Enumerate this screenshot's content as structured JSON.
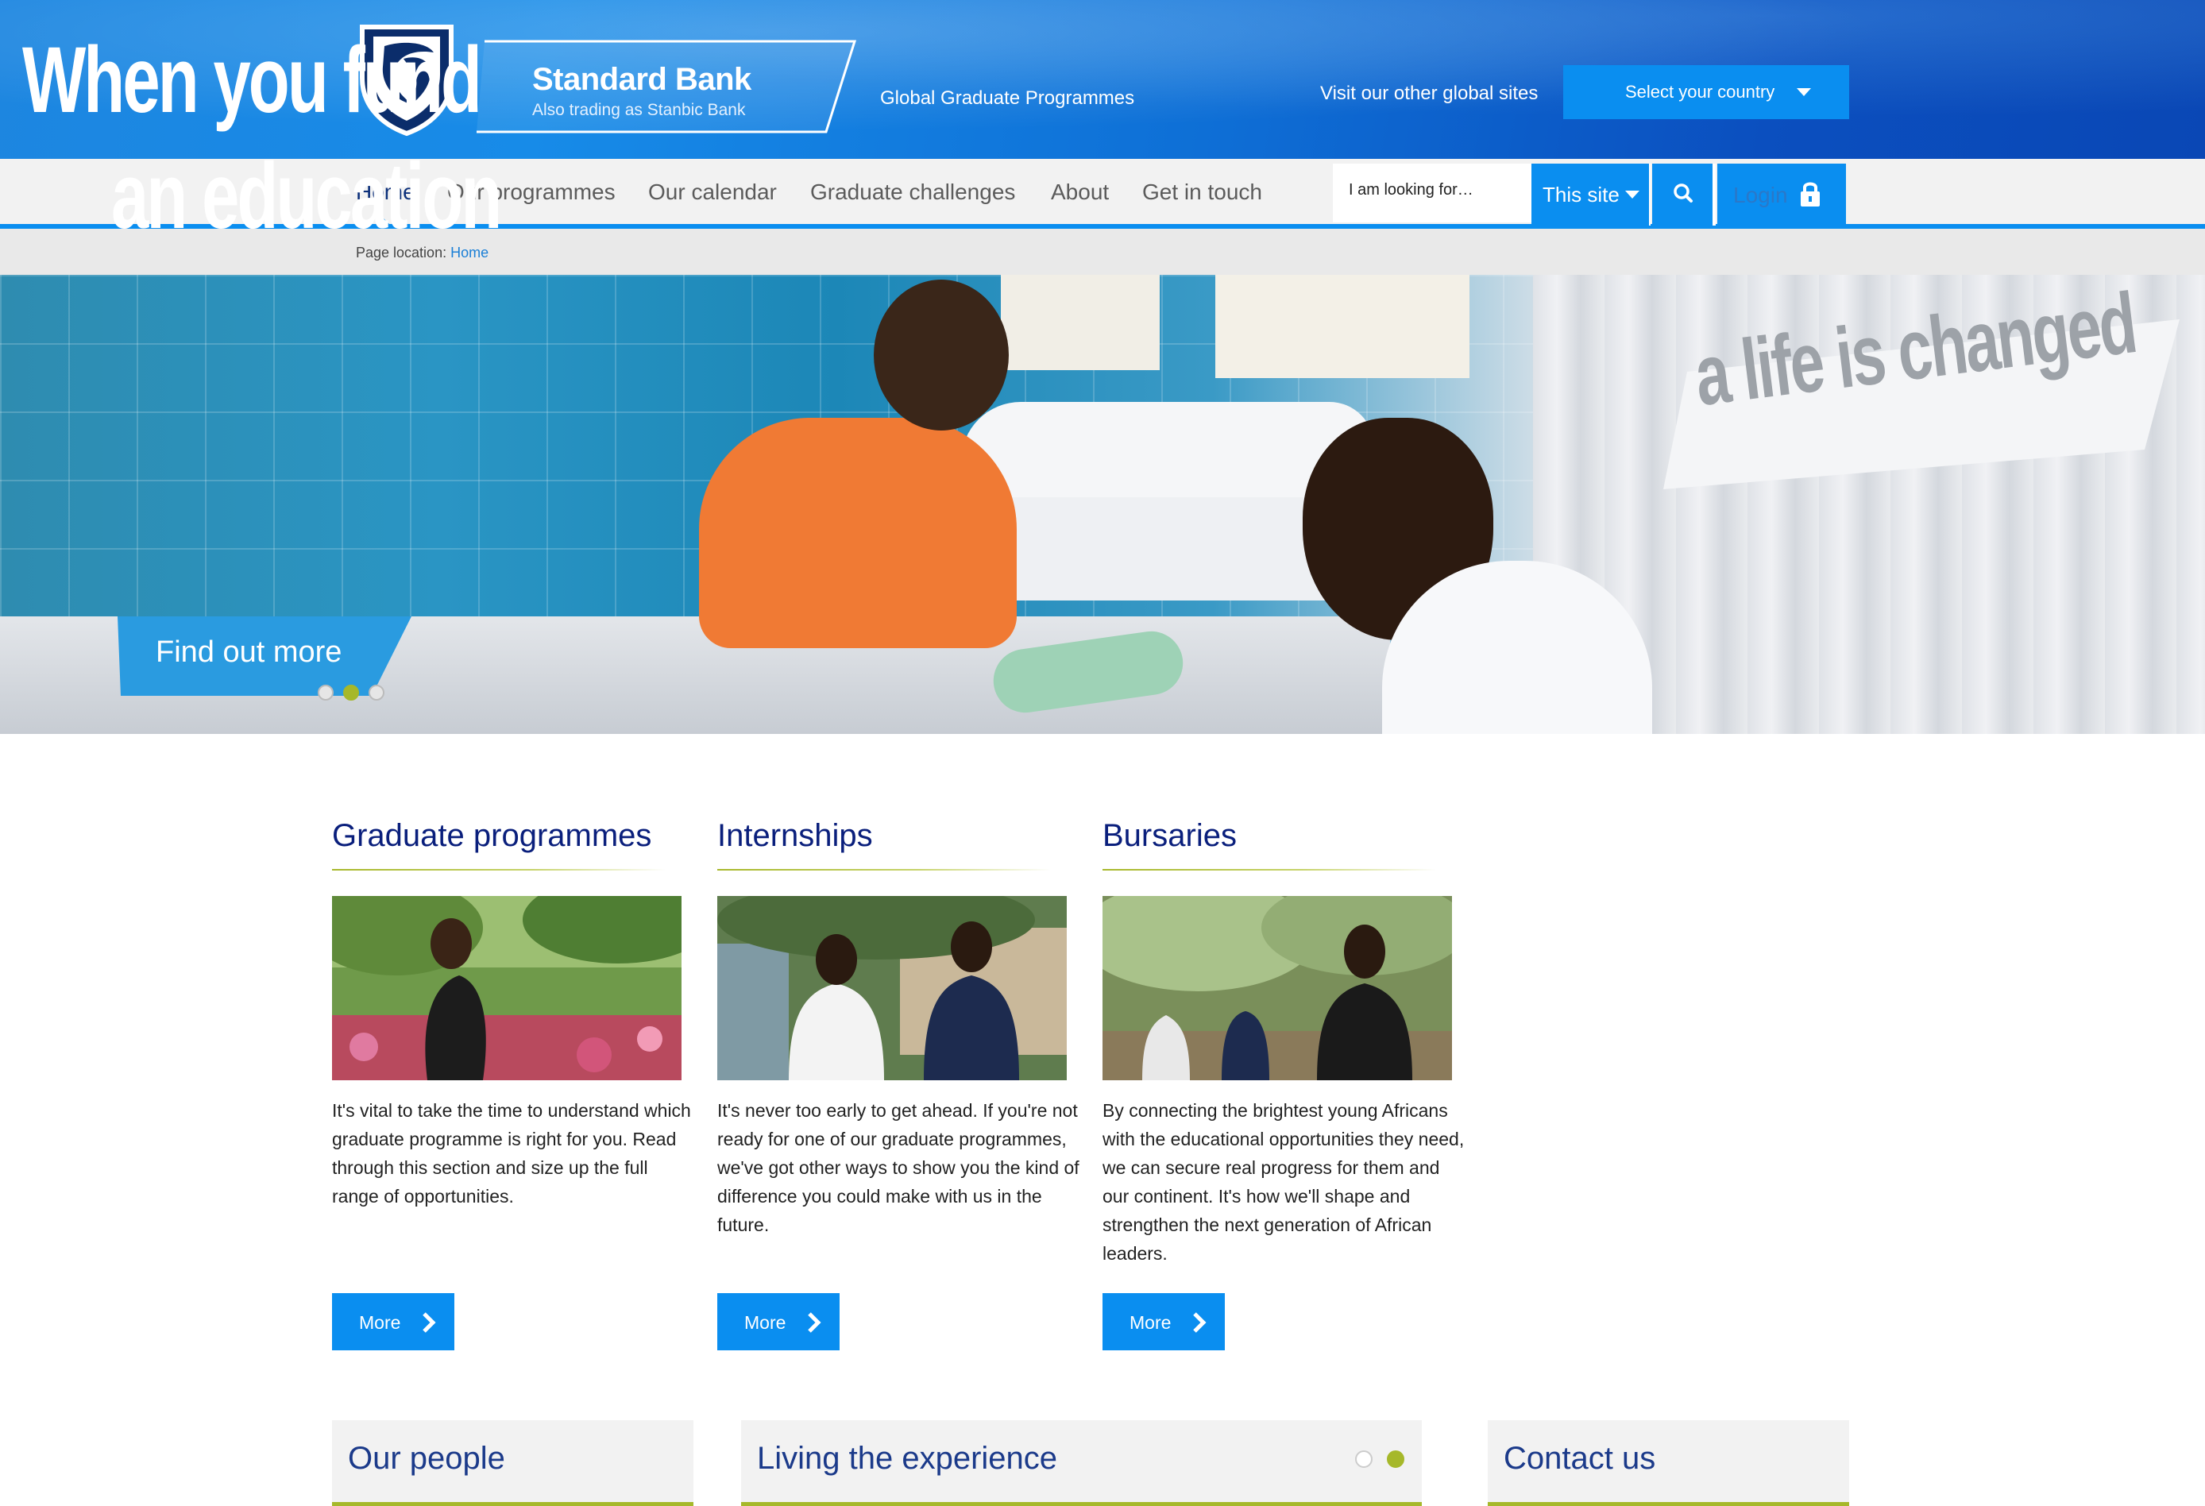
{
  "header": {
    "brand_name": "Standard Bank",
    "brand_tagline": "Also trading as Stanbic Bank",
    "site_name": "Global Graduate Programmes",
    "global_sites_label": "Visit our other global sites",
    "country_select_label": "Select your country"
  },
  "nav": {
    "items": [
      {
        "label": "Home",
        "active": true
      },
      {
        "label": "Our programmes"
      },
      {
        "label": "Our calendar"
      },
      {
        "label": "Graduate challenges"
      },
      {
        "label": "About"
      },
      {
        "label": "Get in touch"
      }
    ],
    "search_value": "I am looking for…",
    "scope_label": "This site",
    "login_label": "Login"
  },
  "breadcrumb": {
    "prefix": "Page location:",
    "current": "Home"
  },
  "hero": {
    "line1": "When you fund",
    "line2": "an education",
    "banner": "a life is changed",
    "cta": "Find out more",
    "active_slide": 2,
    "slide_count": 3
  },
  "cards": [
    {
      "title": "Graduate programmes",
      "text": "It's vital to  take the time to understand which graduate programme is right for you. Read through this section and size up the full range of opportunities.",
      "button": "More"
    },
    {
      "title": "Internships",
      "text": "It's never too early to get ahead. If you're not ready for one of our graduate programmes, we've got other ways to show you the kind of difference you could make with us in the future.",
      "button": "More"
    },
    {
      "title": "Bursaries",
      "text": "By connecting the brightest young Africans with the educational opportunities they need, we can secure real progress for them and our continent. It's how we'll shape and strengthen the next generation of African leaders.",
      "button": "More"
    }
  ],
  "panels": {
    "people": "Our people",
    "experience": "Living the experience",
    "contact": "Contact us",
    "experience_active_slide": 2
  },
  "colors": {
    "brand_blue": "#0a8ef0",
    "navy_heading": "#0a1f7c",
    "accent_green": "#a6b82a"
  }
}
